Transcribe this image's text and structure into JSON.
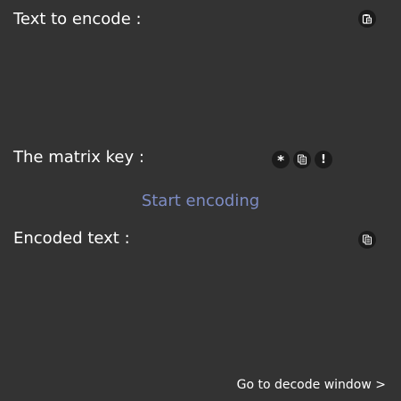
{
  "encode_section": {
    "label": "Text to encode :",
    "paste_icon": "clipboard-paste-icon",
    "input_value": ""
  },
  "key_section": {
    "label": "The matrix key :",
    "key_value": "",
    "random_icon_glyph": "*",
    "copy_icon": "copy-icon",
    "info_icon_glyph": "!"
  },
  "actions": {
    "start_label": "Start encoding"
  },
  "output_section": {
    "label": "Encoded text :",
    "copy_icon": "copy-icon",
    "output_value": ""
  },
  "navigation": {
    "decode_link": "Go to decode window >"
  },
  "colors": {
    "background": "#333333",
    "accent": "#7d8cc4",
    "icon_bg": "#1b1b1b",
    "text": "#ffffff"
  }
}
